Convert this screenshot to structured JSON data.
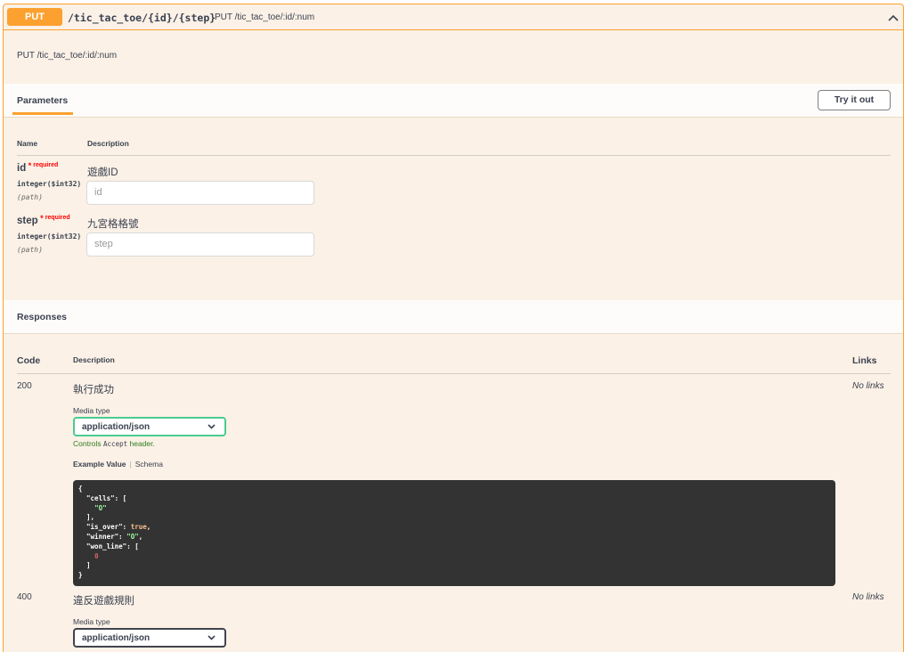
{
  "operation": {
    "method": "PUT",
    "path": "/tic_tac_toe/{id}/{step}",
    "summary": "PUT /tic_tac_toe/:id/:num",
    "description": "PUT /tic_tac_toe/:id/:num"
  },
  "parameters": {
    "tab_label": "Parameters",
    "try_button": "Try it out",
    "col_name": "Name",
    "col_description": "Description",
    "required_star": "*",
    "required_text": "required",
    "items": [
      {
        "name": "id",
        "type": "integer($int32)",
        "in": "(path)",
        "description": "遊戲ID",
        "placeholder": "id"
      },
      {
        "name": "step",
        "type": "integer($int32)",
        "in": "(path)",
        "description": "九宮格格號",
        "placeholder": "step"
      }
    ]
  },
  "responses": {
    "title": "Responses",
    "col_code": "Code",
    "col_description": "Description",
    "col_links": "Links",
    "media_type_label": "Media type",
    "controls_prefix": "Controls",
    "controls_code": "Accept",
    "controls_suffix": "header.",
    "example_tab": "Example Value",
    "schema_tab": "Schema",
    "items": [
      {
        "code": "200",
        "description": "執行成功",
        "media_type": "application/json",
        "links": "No links"
      },
      {
        "code": "400",
        "description": "違反遊戲規則",
        "media_type": "application/json",
        "links": "No links"
      }
    ],
    "example": {
      "l1": "{",
      "cells_key": "\"cells\"",
      "cells_val": "\"O\"",
      "is_over_key": "\"is_over\"",
      "is_over_val": "true",
      "winner_key": "\"winner\"",
      "winner_val": "\"O\"",
      "won_line_key": "\"won_line\"",
      "won_line_val": "0"
    }
  },
  "colors": {
    "put_accent": "#fca130",
    "block_bg": "#fbf1e6",
    "success_green": "#49cc90",
    "code_bg": "#333333"
  },
  "icons": [
    "chevron-up-icon",
    "chevron-down-icon"
  ]
}
